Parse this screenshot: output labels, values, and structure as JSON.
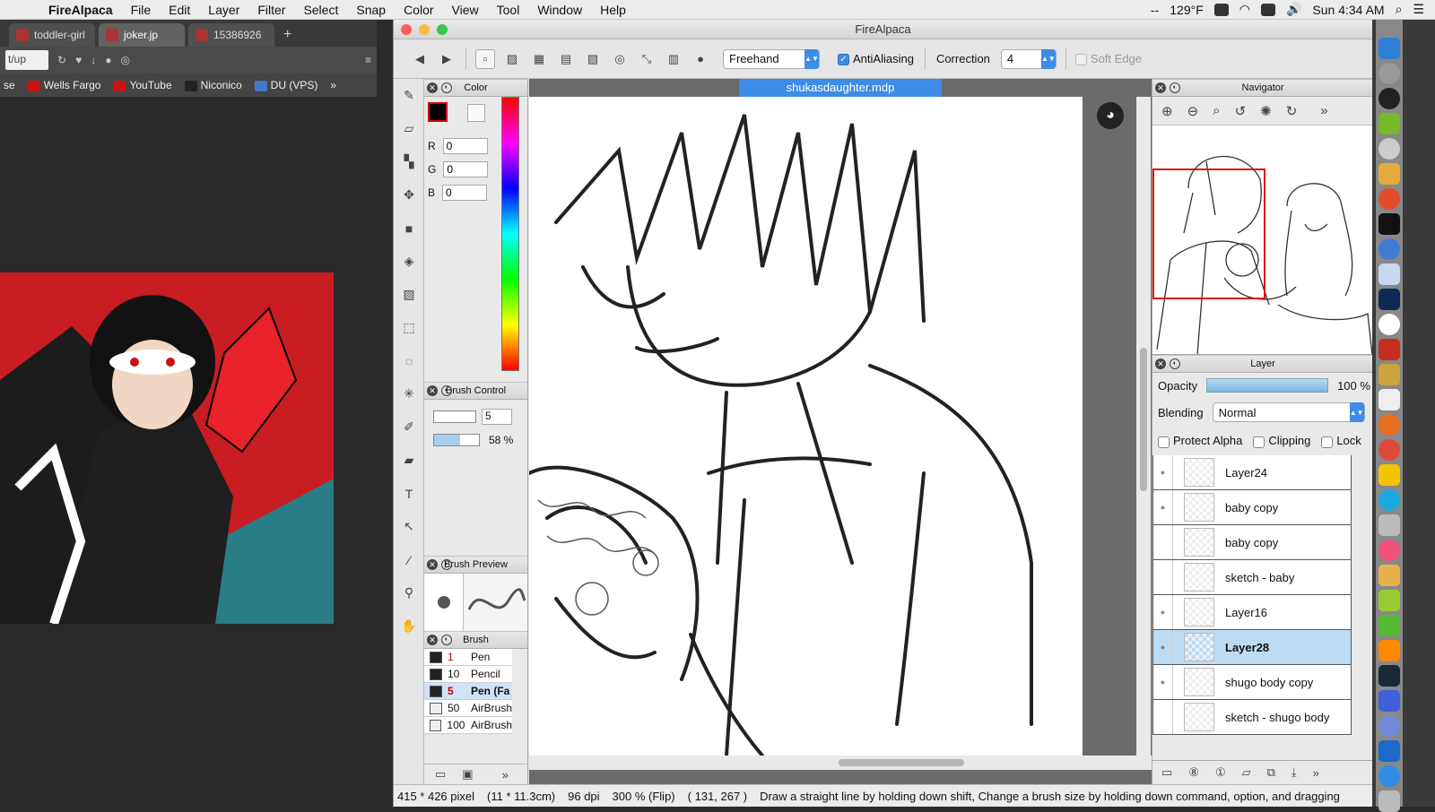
{
  "menubar": {
    "app": "FireAlpaca",
    "items": [
      "File",
      "Edit",
      "Layer",
      "Filter",
      "Select",
      "Snap",
      "Color",
      "View",
      "Tool",
      "Window",
      "Help"
    ],
    "temp": "129°F",
    "clock": "Sun 4:34 AM",
    "dashes": "--"
  },
  "browser": {
    "tabs": [
      "toddler-girl",
      "joker.jp",
      "15386926"
    ],
    "address": "t/up",
    "bookmarks": [
      "se",
      "Wells Fargo",
      "YouTube",
      "Niconico",
      "DU (VPS)"
    ]
  },
  "window": {
    "title": "FireAlpaca"
  },
  "toolbar": {
    "mode": "Freehand",
    "antialiasing": "AntiAliasing",
    "correction_label": "Correction",
    "correction_value": "4",
    "soft_edge": "Soft Edge"
  },
  "color_panel": {
    "title": "Color",
    "r_label": "R",
    "g_label": "G",
    "b_label": "B",
    "r": "0",
    "g": "0",
    "b": "0"
  },
  "brush_control": {
    "title": "Brush Control",
    "size": "5",
    "opacity": "58 %"
  },
  "brush_preview": {
    "title": "Brush Preview"
  },
  "brush_panel": {
    "title": "Brush",
    "items": [
      {
        "size": "1",
        "name": "Pen"
      },
      {
        "size": "10",
        "name": "Pencil"
      },
      {
        "size": "5",
        "name": "Pen (Fa"
      },
      {
        "size": "50",
        "name": "AirBrush"
      },
      {
        "size": "100",
        "name": "AirBrush"
      }
    ]
  },
  "document": {
    "tab": "shukasdaughter.mdp"
  },
  "navigator": {
    "title": "Navigator"
  },
  "layer_panel": {
    "title": "Layer",
    "opacity_label": "Opacity",
    "opacity_value": "100 %",
    "blending_label": "Blending",
    "blending_value": "Normal",
    "protect_alpha": "Protect Alpha",
    "clipping": "Clipping",
    "lock": "Lock",
    "layers": [
      "Layer24",
      "baby copy",
      "baby copy",
      "sketch - baby",
      "Layer16",
      "Layer28",
      "shugo body copy",
      "sketch - shugo body"
    ],
    "selected": "Layer28"
  },
  "status": {
    "size": "415 * 426 pixel",
    "cm": "(11 * 11.3cm)",
    "dpi": "96 dpi",
    "zoom": "300 % (Flip)",
    "coords": "( 131, 267 )",
    "hint": "Draw a straight line by holding down shift, Change a brush size by holding down command, option, and dragging"
  },
  "colors": {
    "accent": "#3d8ce8",
    "selected_layer": "#bcdcf6",
    "close": "#fc605c",
    "minimize": "#fdbc40",
    "zoom": "#34c84a"
  }
}
